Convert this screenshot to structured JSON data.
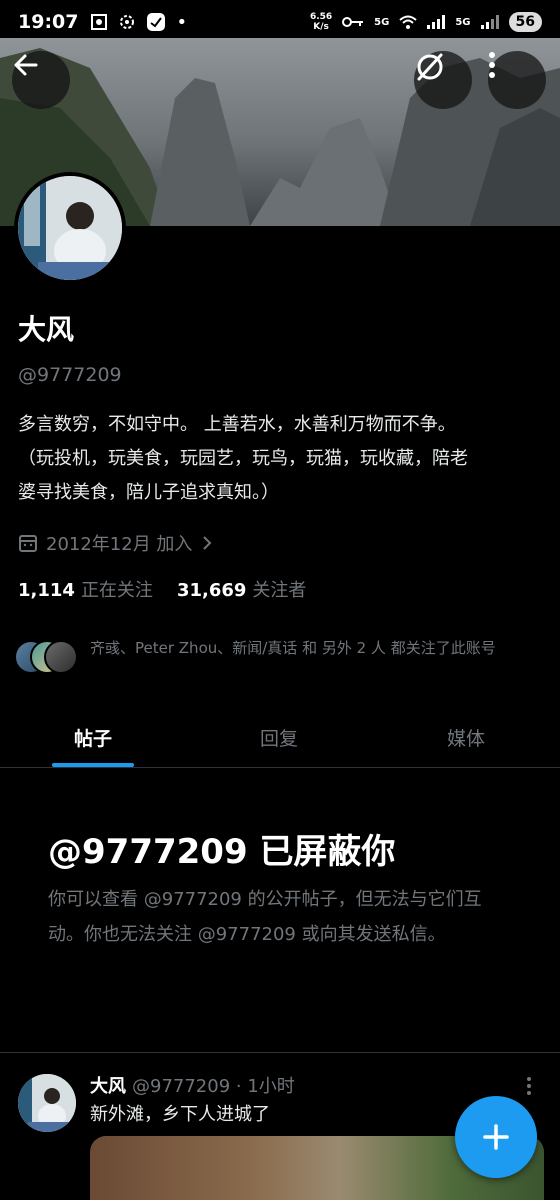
{
  "status_bar": {
    "time": "19:07",
    "net_speed_value": "6.56",
    "net_speed_unit": "K/s",
    "signal_1": "5G",
    "signal_2": "5G",
    "battery": "56"
  },
  "profile": {
    "display_name": "大风",
    "handle": "@9777209",
    "bio_line1": "多言数穷，不如守中。 上善若水，水善利万物而不争。",
    "bio_line2": "（玩投机，玩美食，玩园艺，玩鸟，玩猫，玩收藏，陪老",
    "bio_line3": "婆寻找美食，陪儿子追求真知。）",
    "joined": "2012年12月 加入",
    "following_count": "1,114",
    "following_label": "正在关注",
    "followers_count": "31,669",
    "followers_label": "关注者",
    "followed_by": "齐彧、Peter Zhou、新闻/真话 和 另外 2 人 都关注了此账号"
  },
  "tabs": [
    {
      "label": "帖子",
      "active": true
    },
    {
      "label": "回复",
      "active": false
    },
    {
      "label": "媒体",
      "active": false
    }
  ],
  "blocked": {
    "title": "@9777209 已屏蔽你",
    "description": "你可以查看 @9777209 的公开帖子，但无法与它们互动。你也无法关注 @9777209 或向其发送私信。"
  },
  "tweet": {
    "name": "大风",
    "handle_time": "@9777209 · 1小时",
    "text": "新外滩，乡下人进城了"
  },
  "colors": {
    "accent": "#1d9bf0",
    "background": "#000000",
    "secondary_text": "#71767b"
  },
  "icons": [
    "back-arrow-icon",
    "grok-icon",
    "more-vertical-icon",
    "calendar-icon",
    "chevron-right-icon",
    "plus-icon"
  ]
}
